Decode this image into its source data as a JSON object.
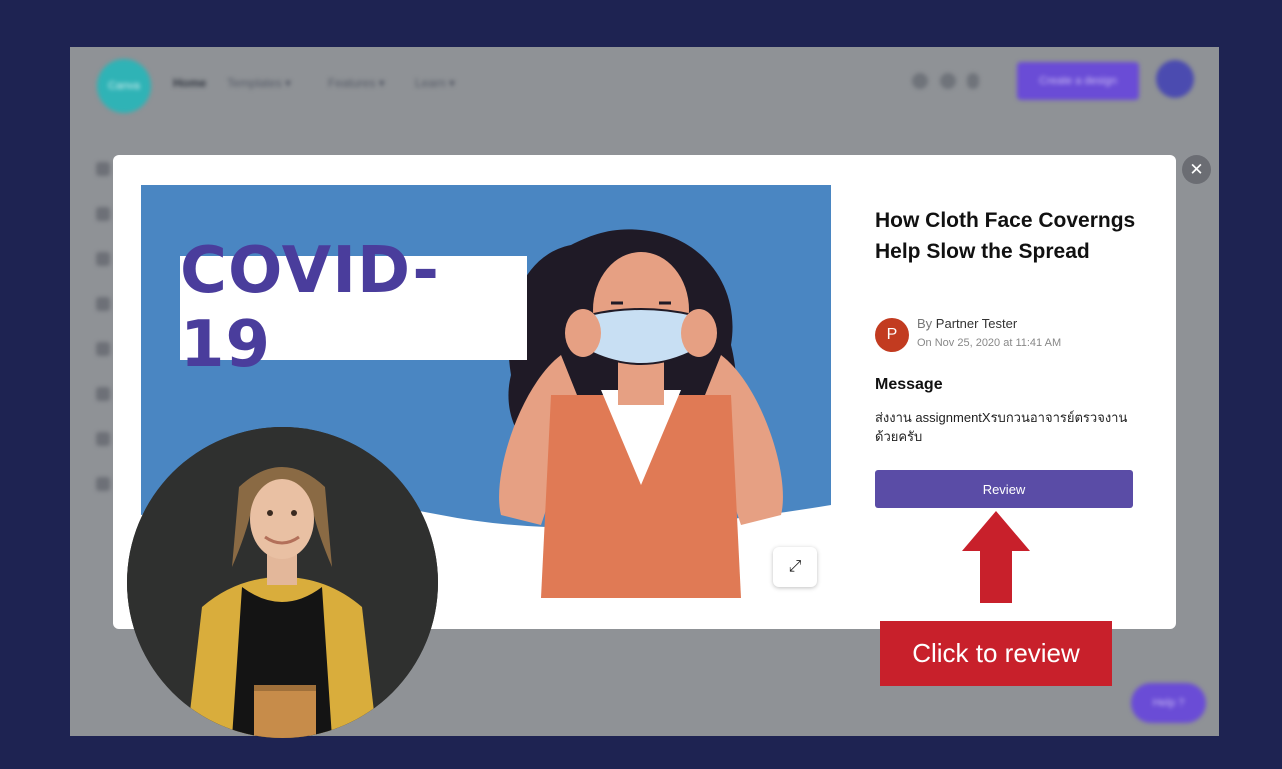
{
  "background_app": {
    "logo": "Canva",
    "nav": [
      "Home",
      "Templates ▾",
      "Features ▾",
      "Learn ▾"
    ],
    "create_button": "Create a design",
    "help_button": "Help ?"
  },
  "modal": {
    "title": "How Cloth Face Coverngs Help Slow the Spread",
    "preview_text": "COVID-19",
    "author": {
      "initial": "P",
      "by_label": "By",
      "name": "Partner Tester",
      "date": "On Nov 25, 2020 at 11:41 AM"
    },
    "message_heading": "Message",
    "message_body": "ส่งงาน assignmentXรบกวนอาจารย์ตรวจงานด้วยครับ",
    "review_button": "Review",
    "close_icon": "close-icon",
    "expand_icon": "expand-icon"
  },
  "annotation": {
    "callout": "Click to review",
    "arrow_color": "#c8202b"
  },
  "colors": {
    "frame": "#1e2352",
    "review_button": "#5a4ca6",
    "preview_bg": "#4a86c2",
    "callout": "#c8202b"
  }
}
